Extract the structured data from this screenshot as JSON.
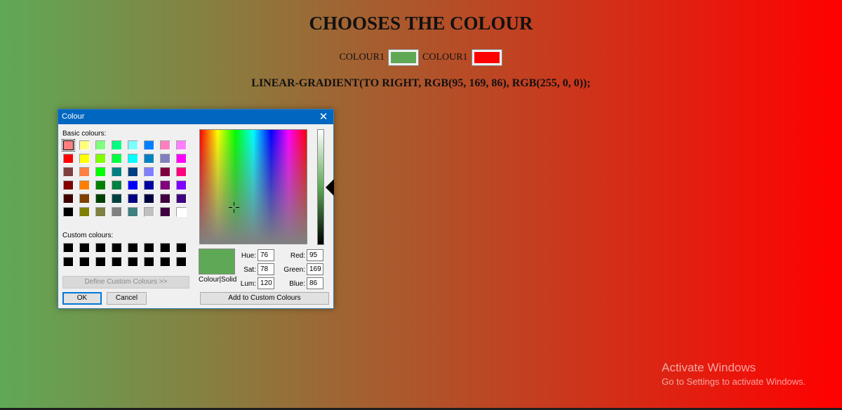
{
  "page": {
    "title": "CHOOSES THE COLOUR",
    "colour1_label": "COLOUR1",
    "colour2_label": "COLOUR1",
    "colour1_value": "#5fa956",
    "colour2_value": "#ff0000",
    "gradient_css": "LINEAR-GRADIENT(TO RIGHT, RGB(95, 169, 86), RGB(255, 0, 0));"
  },
  "dialog": {
    "title": "Colour",
    "close_icon": "close-icon",
    "basic_label": "Basic colours:",
    "custom_label": "Custom colours:",
    "basic_colours": [
      "#ff8080",
      "#ffff80",
      "#80ff80",
      "#00ff80",
      "#80ffff",
      "#0080ff",
      "#ff80c0",
      "#ff80ff",
      "#ff0000",
      "#ffff00",
      "#80ff00",
      "#00ff40",
      "#00ffff",
      "#0080c0",
      "#8080c0",
      "#ff00ff",
      "#804040",
      "#ff8040",
      "#00ff00",
      "#008080",
      "#004080",
      "#8080ff",
      "#800040",
      "#ff0080",
      "#800000",
      "#ff8000",
      "#008000",
      "#008040",
      "#0000ff",
      "#0000a0",
      "#800080",
      "#8000ff",
      "#400000",
      "#804000",
      "#004000",
      "#004040",
      "#000080",
      "#000040",
      "#400040",
      "#400080",
      "#000000",
      "#808000",
      "#808040",
      "#808080",
      "#408080",
      "#c0c0c0",
      "#400040",
      "#ffffff"
    ],
    "custom_colours": [
      "#000000",
      "#000000",
      "#000000",
      "#000000",
      "#000000",
      "#000000",
      "#000000",
      "#000000",
      "#000000",
      "#000000",
      "#000000",
      "#000000",
      "#000000",
      "#000000",
      "#000000",
      "#000000"
    ],
    "define_custom_label": "Define Custom Colours >>",
    "ok_label": "OK",
    "cancel_label": "Cancel",
    "preview_label": "Colour|Solid",
    "hue_label": "Hue:",
    "sat_label": "Sat:",
    "lum_label": "Lum:",
    "red_label": "Red:",
    "green_label": "Green:",
    "blue_label": "Blue:",
    "hue": "76",
    "sat": "78",
    "lum": "120",
    "red": "95",
    "green": "169",
    "blue": "86",
    "add_custom_label": "Add to Custom Colours",
    "selected_colour": "#5fa956"
  },
  "watermark": {
    "line1": "Activate Windows",
    "line2": "Go to Settings to activate Windows."
  }
}
